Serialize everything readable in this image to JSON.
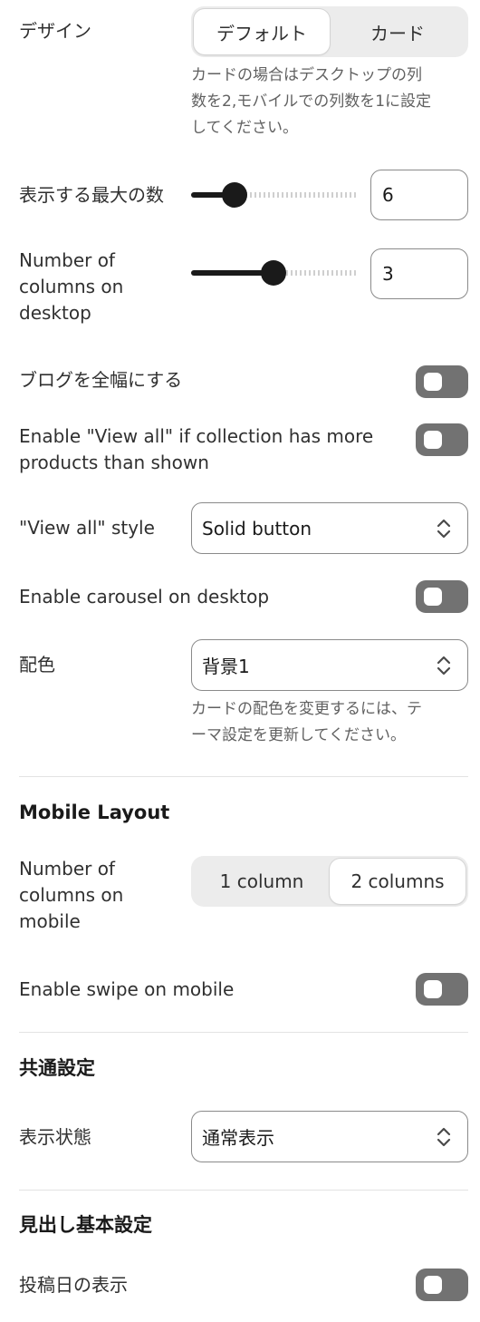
{
  "design": {
    "label": "デザイン",
    "options": [
      "デフォルト",
      "カード"
    ],
    "selected": "デフォルト",
    "help": [
      "カードの場合はデスクトップの列",
      "数を2,モバイルでの列数を1に設定",
      "してください。"
    ]
  },
  "max_items": {
    "label": "表示する最大の数",
    "value": "6",
    "slider_fraction": 0.26
  },
  "columns_desktop": {
    "label_lines": [
      "Number of",
      "columns on",
      "desktop"
    ],
    "value": "3",
    "slider_fraction": 0.5
  },
  "full_width_blog": {
    "label": "ブログを全幅にする",
    "on": false
  },
  "view_all": {
    "label_lines": [
      "Enable \"View all\" if collection has more",
      "products than shown"
    ],
    "on": false
  },
  "view_all_style": {
    "label": "\"View all\" style",
    "value": "Solid button"
  },
  "carousel_desktop": {
    "label": "Enable carousel on desktop",
    "on": false
  },
  "color_scheme": {
    "label": "配色",
    "value": "背景1",
    "help": [
      "カードの配色を変更するには、テ",
      "ーマ設定を更新してください。"
    ]
  },
  "mobile_layout": {
    "heading": "Mobile Layout",
    "columns_label_lines": [
      "Number of",
      "columns on",
      "mobile"
    ],
    "options": [
      "1 column",
      "2 columns"
    ],
    "selected": "2 columns",
    "swipe_label": "Enable swipe on mobile",
    "swipe_on": false
  },
  "common": {
    "heading": "共通設定",
    "visibility_label": "表示状態",
    "visibility_value": "通常表示"
  },
  "heading_settings": {
    "heading": "見出し基本設定",
    "post_date_label": "投稿日の表示",
    "post_date_on": false
  },
  "colors": {
    "toggle_off": "#727272",
    "slider_fill": "#1a1a1a",
    "segment_bg": "#ececec"
  }
}
